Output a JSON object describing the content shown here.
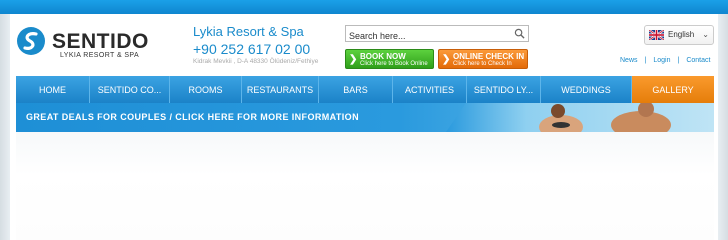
{
  "logo": {
    "name": "SENTIDO",
    "subtitle": "LYKIA RESORT & SPA"
  },
  "resort": {
    "title": "Lykia Resort & Spa",
    "phone": "+90 252 617 02 00",
    "address": "Kidrak Mevkii , D-A 48330 Ölüdeniz/Fethiye"
  },
  "search": {
    "placeholder": "Search here..."
  },
  "buttons": {
    "book_main": "BOOK NOW",
    "book_sub": "Click here to Book Online",
    "checkin_main": "ONLINE CHECK IN",
    "checkin_sub": "Click here to Check In"
  },
  "language": {
    "selected": "English"
  },
  "toplinks": [
    "News",
    "Login",
    "Contact"
  ],
  "nav": [
    "HOME",
    "SENTIDO CO...",
    "ROOMS",
    "RESTAURANTS",
    "BARS",
    "ACTIVITIES",
    "SENTIDO LY...",
    "WEDDINGS",
    "GALLERY"
  ],
  "banner": {
    "text": "GREAT DEALS FOR COUPLES / CLICK HERE FOR MORE INFORMATION"
  },
  "colors": {
    "brand_blue": "#1e8fd6",
    "nav_blue": "#2a93d6",
    "gallery_orange": "#f08c18",
    "book_green": "#3fb826",
    "checkin_orange": "#f07c18"
  }
}
